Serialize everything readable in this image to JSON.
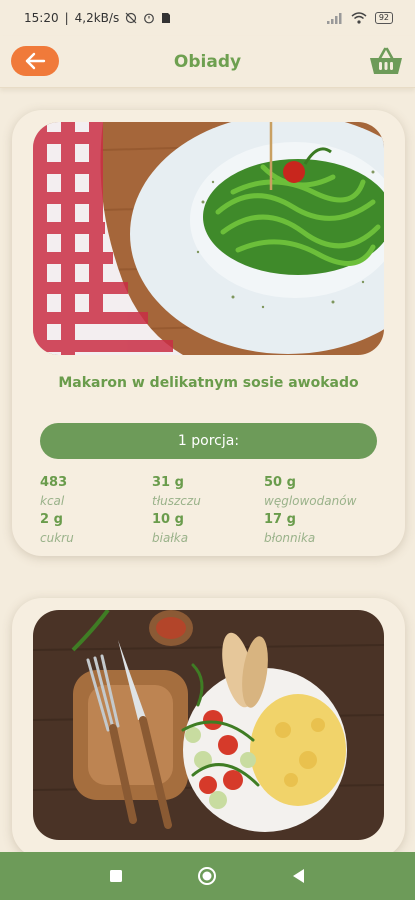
{
  "status_bar": {
    "time": "15:20",
    "network_speed": "4,2kB/s",
    "battery": "92"
  },
  "app_bar": {
    "title": "Obiady"
  },
  "recipes": [
    {
      "title": "Makaron w delikatnym sosie awokado",
      "portion": "1 porcja:",
      "nutrition": [
        {
          "value": "483",
          "label": "kcal"
        },
        {
          "value": "31 g",
          "label": "tłuszczu"
        },
        {
          "value": "50 g",
          "label": "węglowodanów"
        },
        {
          "value": "2 g",
          "label": "cukru"
        },
        {
          "value": "10 g",
          "label": "białka"
        },
        {
          "value": "17 g",
          "label": "błonnika"
        }
      ]
    }
  ],
  "colors": {
    "accent_green": "#6d9b59",
    "title_green": "#6a9c4c",
    "back_button_orange": "#f07a3a",
    "background": "#f4ecdd"
  }
}
